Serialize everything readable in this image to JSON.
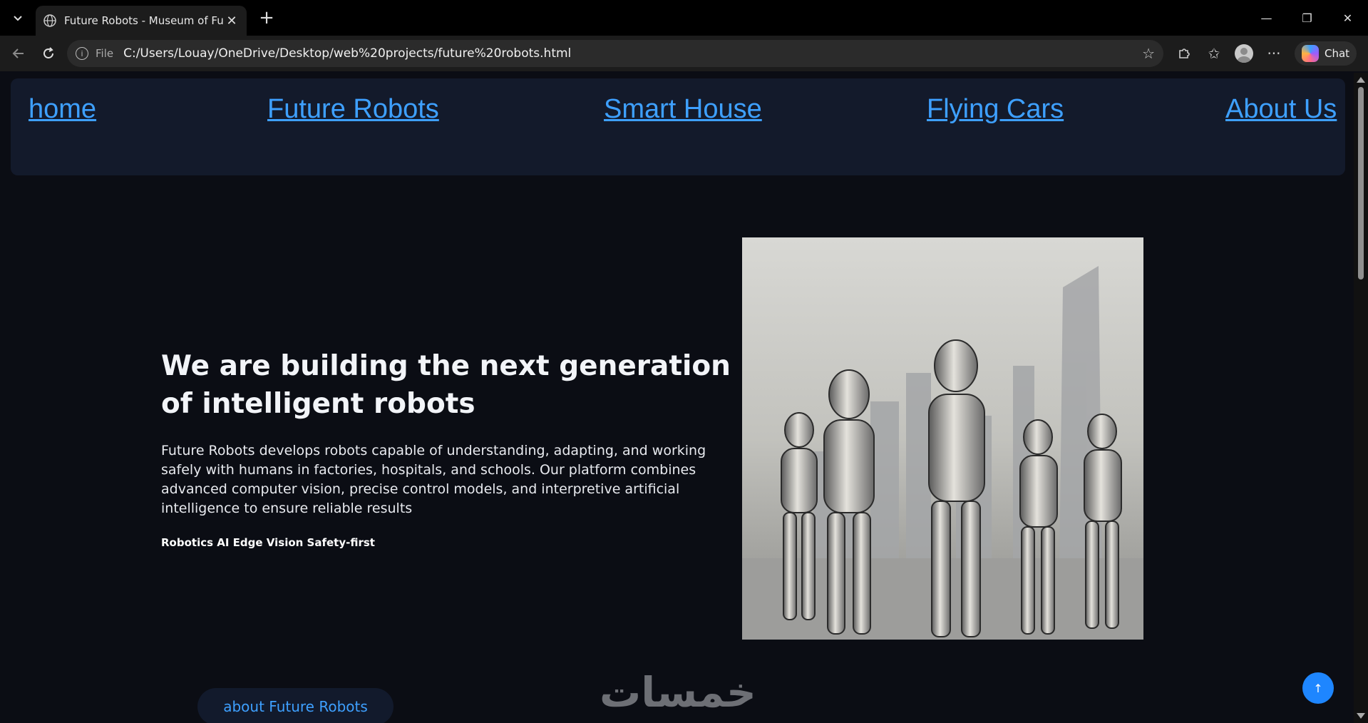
{
  "browser": {
    "tab_title": "Future Robots - Museum of Future",
    "address_scheme": "File",
    "address_url": "C:/Users/Louay/OneDrive/Desktop/web%20projects/future%20robots.html",
    "chat_label": "Chat"
  },
  "nav": {
    "items": [
      {
        "label": "home"
      },
      {
        "label": "Future Robots"
      },
      {
        "label": "Smart House"
      },
      {
        "label": "Flying Cars"
      },
      {
        "label": "About Us"
      }
    ]
  },
  "hero": {
    "title": "We are building the next generation of intelligent robots",
    "description": "Future Robots develops robots capable of understanding, adapting, and working safely with humans in factories, hospitals, and schools. Our platform combines advanced computer vision, precise control models, and interpretive artificial intelligence to ensure reliable results",
    "tags": "Robotics AI Edge Vision Safety-first",
    "image_alt": "Humanoid robots standing in front of a city skyline"
  },
  "about_button": "about Future Robots",
  "watermark": "خمسات",
  "to_top_icon": "↑",
  "icons": {
    "tab_menu": "chevron-down-icon",
    "globe": "globe-icon",
    "close": "close-icon",
    "new_tab": "plus-icon",
    "back": "arrow-left-icon",
    "reload": "reload-icon",
    "info": "info-icon",
    "favorite": "star-icon",
    "extensions": "puzzle-icon",
    "favorites": "favorites-icon",
    "more": "more-icon"
  }
}
